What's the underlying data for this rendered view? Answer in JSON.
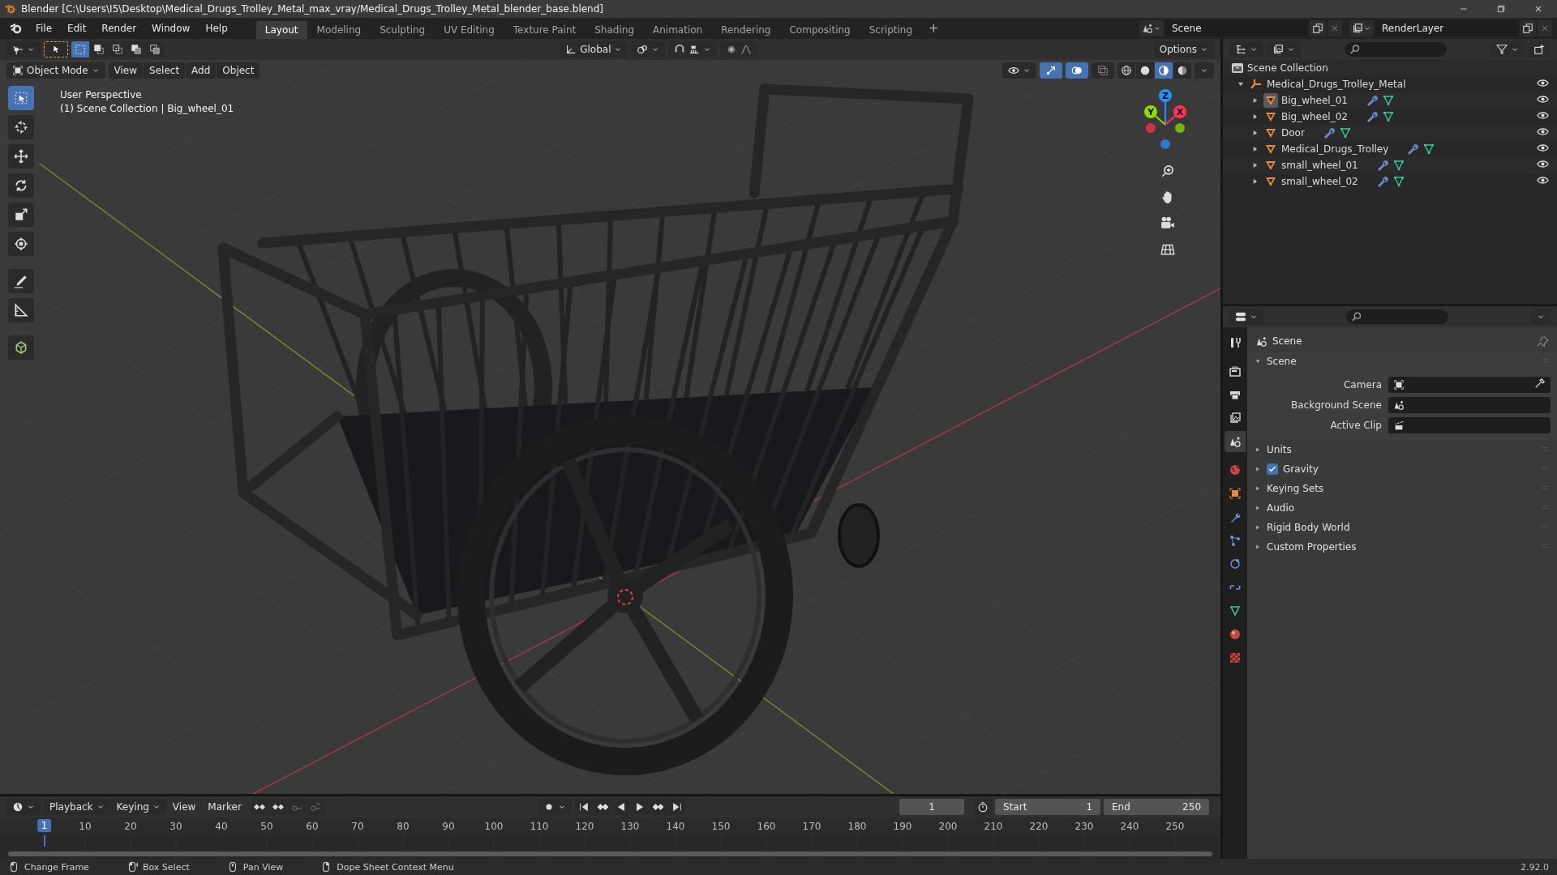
{
  "window": {
    "title": "Blender [C:\\Users\\I5\\Desktop\\Medical_Drugs_Trolley_Metal_max_vray/Medical_Drugs_Trolley_Metal_blender_base.blend]"
  },
  "menu": [
    "File",
    "Edit",
    "Render",
    "Window",
    "Help"
  ],
  "workspaces": [
    {
      "label": "Layout",
      "selected": true
    },
    {
      "label": "Modeling",
      "selected": false
    },
    {
      "label": "Sculpting",
      "selected": false
    },
    {
      "label": "UV Editing",
      "selected": false
    },
    {
      "label": "Texture Paint",
      "selected": false
    },
    {
      "label": "Shading",
      "selected": false
    },
    {
      "label": "Animation",
      "selected": false
    },
    {
      "label": "Rendering",
      "selected": false
    },
    {
      "label": "Compositing",
      "selected": false
    },
    {
      "label": "Scripting",
      "selected": false
    }
  ],
  "add_workspace": "+",
  "scene": {
    "value": "Scene"
  },
  "view_layer": {
    "value": "RenderLayer"
  },
  "tool_settings": {
    "select_modes": [
      {
        "selected": true
      },
      {
        "selected": false
      },
      {
        "selected": false
      },
      {
        "selected": false
      },
      {
        "selected": false
      }
    ],
    "orientation": "Global",
    "options": "Options"
  },
  "viewport": {
    "mode": "Object Mode",
    "menus": [
      "View",
      "Select",
      "Add",
      "Object"
    ],
    "gizmos": true,
    "overlays": true,
    "xray": false,
    "shading_modes": [
      {
        "kind": "wireframe",
        "selected": false
      },
      {
        "kind": "solid",
        "selected": false
      },
      {
        "kind": "material",
        "selected": true
      },
      {
        "kind": "rendered",
        "selected": false
      }
    ],
    "overlay_text": [
      "User Perspective",
      "(1) Scene Collection | Big_wheel_01"
    ],
    "gizmo_axes": [
      {
        "label": "Z",
        "color": "#2890ff"
      },
      {
        "label": "Y",
        "color": "#8bdc00"
      },
      {
        "label": "X",
        "color": "#ff3352"
      }
    ],
    "tools": [
      {
        "kind": "select",
        "selected": true
      },
      {
        "kind": "cursor",
        "selected": false
      },
      {
        "kind": "move",
        "selected": false
      },
      {
        "kind": "rotate",
        "selected": false
      },
      {
        "kind": "scale",
        "selected": false
      },
      {
        "kind": "transform",
        "selected": false
      },
      {
        "kind": "annotate",
        "selected": false
      },
      {
        "kind": "measure",
        "selected": false
      },
      {
        "kind": "add-cube",
        "selected": false
      }
    ]
  },
  "outliner": {
    "root": "Scene Collection",
    "tree": [
      {
        "label": "Medical_Drugs_Trolley_Metal",
        "kind": "collection",
        "expanded": true,
        "selected": false,
        "children": [
          {
            "label": "Big_wheel_01",
            "kind": "mesh",
            "expanded": false,
            "selected": true
          },
          {
            "label": "Big_wheel_02",
            "kind": "mesh",
            "expanded": false,
            "selected": false
          },
          {
            "label": "Door",
            "kind": "mesh",
            "expanded": false,
            "selected": false
          },
          {
            "label": "Medical_Drugs_Trolley",
            "kind": "mesh",
            "expanded": false,
            "selected": false
          },
          {
            "label": "small_wheel_01",
            "kind": "mesh",
            "expanded": false,
            "selected": false
          },
          {
            "label": "small_wheel_02",
            "kind": "mesh",
            "expanded": false,
            "selected": false
          }
        ]
      }
    ]
  },
  "properties": {
    "tabs": [
      {
        "kind": "tool",
        "selected": false
      },
      {
        "kind": "render",
        "selected": false
      },
      {
        "kind": "output",
        "selected": false
      },
      {
        "kind": "view-layer",
        "selected": false
      },
      {
        "kind": "scene",
        "selected": true
      },
      {
        "kind": "world",
        "selected": false
      },
      {
        "kind": "object",
        "selected": false
      },
      {
        "kind": "modifiers",
        "selected": false
      },
      {
        "kind": "particles",
        "selected": false
      },
      {
        "kind": "physics",
        "selected": false
      },
      {
        "kind": "constraints",
        "selected": false
      },
      {
        "kind": "data",
        "selected": false
      },
      {
        "kind": "material",
        "selected": false
      },
      {
        "kind": "texture",
        "selected": false
      }
    ],
    "context": "Scene",
    "panels": [
      {
        "title": "Scene",
        "kind": "plain",
        "expanded": true,
        "fields": [
          {
            "label": "Camera",
            "kind": "camera"
          },
          {
            "label": "Background Scene",
            "kind": "scene"
          },
          {
            "label": "Active Clip",
            "kind": "clip"
          }
        ]
      },
      {
        "title": "Units",
        "kind": "plain",
        "expanded": false
      },
      {
        "title": "Gravity",
        "kind": "checkbox",
        "checked": true,
        "expanded": false
      },
      {
        "title": "Keying Sets",
        "kind": "plain",
        "expanded": false
      },
      {
        "title": "Audio",
        "kind": "plain",
        "expanded": false
      },
      {
        "title": "Rigid Body World",
        "kind": "plain",
        "expanded": false
      },
      {
        "title": "Custom Properties",
        "kind": "plain",
        "expanded": false
      }
    ]
  },
  "timeline": {
    "menus": [
      {
        "label": "Playback",
        "dropdown": true
      },
      {
        "label": "Keying",
        "dropdown": true
      },
      {
        "label": "View",
        "dropdown": false
      },
      {
        "label": "Marker",
        "dropdown": false
      }
    ],
    "current_frame": "1",
    "start_label": "Start",
    "start": "1",
    "end_label": "End",
    "end": "250",
    "frame_marker": "1",
    "ruler_labels": [
      "10",
      "20",
      "30",
      "40",
      "50",
      "60",
      "70",
      "80",
      "90",
      "100",
      "110",
      "120",
      "130",
      "140",
      "150",
      "160",
      "170",
      "180",
      "190",
      "200",
      "210",
      "220",
      "230",
      "240",
      "250"
    ]
  },
  "status_bar": {
    "hints": [
      {
        "label": "Change Frame",
        "kind": "left"
      },
      {
        "label": "Box Select",
        "kind": "drag"
      },
      {
        "label": "Pan View",
        "kind": "middle"
      },
      {
        "label": "Dope Sheet Context Menu",
        "kind": "right"
      }
    ],
    "version": "2.92.0"
  }
}
